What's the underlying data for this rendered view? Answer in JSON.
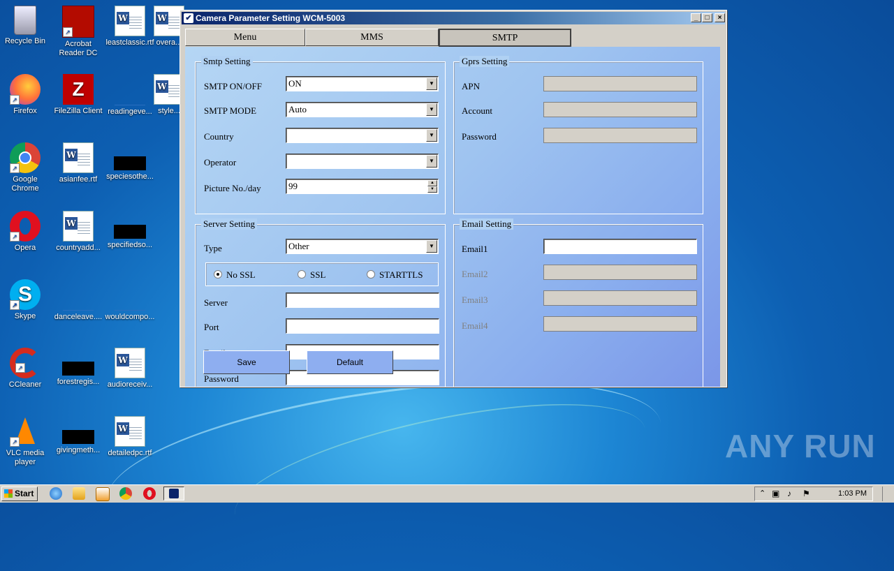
{
  "desktop": {
    "icons": [
      {
        "label": "Recycle Bin",
        "icon": "recycle-bin-icon"
      },
      {
        "label": "Acrobat Reader DC",
        "icon": "acrobat-icon"
      },
      {
        "label": "leastclassic.rtf",
        "icon": "word-doc-icon"
      },
      {
        "label": "overa...",
        "icon": "word-doc-icon"
      },
      {
        "label": "Firefox",
        "icon": "firefox-icon"
      },
      {
        "label": "FileZilla Client",
        "icon": "filezilla-icon"
      },
      {
        "label": "readingeve...",
        "icon": "file-icon"
      },
      {
        "label": "style...",
        "icon": "word-doc-icon"
      },
      {
        "label": "Google Chrome",
        "icon": "chrome-icon"
      },
      {
        "label": "asianfee.rtf",
        "icon": "word-doc-icon"
      },
      {
        "label": "speciesothe...",
        "icon": "file-icon"
      },
      {
        "label": "Opera",
        "icon": "opera-icon"
      },
      {
        "label": "countryadd...",
        "icon": "word-doc-icon"
      },
      {
        "label": "specifiedso...",
        "icon": "file-icon"
      },
      {
        "label": "Skype",
        "icon": "skype-icon"
      },
      {
        "label": "danceleave....",
        "icon": "file-icon"
      },
      {
        "label": "wouldcompo...",
        "icon": "file-icon"
      },
      {
        "label": "CCleaner",
        "icon": "ccleaner-icon"
      },
      {
        "label": "forestregis...",
        "icon": "file-icon"
      },
      {
        "label": "audioreceiv...",
        "icon": "word-doc-icon"
      },
      {
        "label": "VLC media player",
        "icon": "vlc-icon"
      },
      {
        "label": "givingmeth...",
        "icon": "file-icon"
      },
      {
        "label": "detailedpc.rtf",
        "icon": "word-doc-icon"
      }
    ],
    "watermark": "ANY RUN"
  },
  "window": {
    "title": "Camera Parameter Setting WCM-5003",
    "tabs": [
      "Menu",
      "MMS",
      "SMTP"
    ],
    "active_tab": "SMTP",
    "smtp_setting": {
      "title": "Smtp Setting",
      "onoff_label": "SMTP ON/OFF",
      "onoff_value": "ON",
      "mode_label": "SMTP MODE",
      "mode_value": "Auto",
      "country_label": "Country",
      "country_value": "",
      "operator_label": "Operator",
      "operator_value": "",
      "picture_label": "Picture No./day",
      "picture_value": "99"
    },
    "gprs_setting": {
      "title": "Gprs Setting",
      "apn_label": "APN",
      "account_label": "Account",
      "password_label": "Password"
    },
    "server_setting": {
      "title": "Server Setting",
      "type_label": "Type",
      "type_value": "Other",
      "ssl_options": [
        "No SSL",
        "SSL",
        "STARTTLS"
      ],
      "ssl_selected": "No SSL",
      "server_label": "Server",
      "port_label": "Port",
      "email_label": "Email",
      "password_label": "Password"
    },
    "email_setting": {
      "title": "Email Setting",
      "email1_label": "Email1",
      "email2_label": "Email2",
      "email3_label": "Email3",
      "email4_label": "Email4"
    },
    "buttons": {
      "save": "Save",
      "default": "Default"
    }
  },
  "taskbar": {
    "start_label": "Start",
    "clock": "1:03 PM"
  }
}
